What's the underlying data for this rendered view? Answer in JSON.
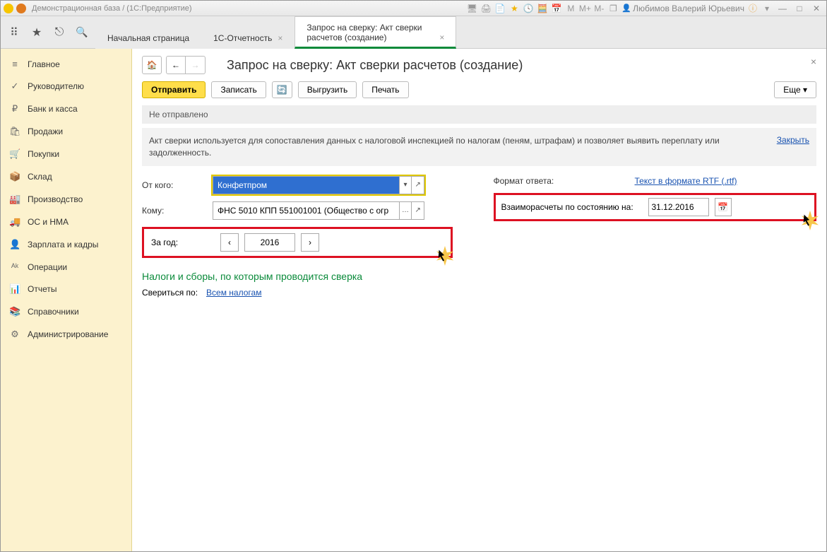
{
  "titlebar": {
    "title": "Демонстрационная база / (1С:Предприятие)",
    "user": "Любимов Валерий Юрьевич",
    "m_labels": [
      "M",
      "M+",
      "M-"
    ]
  },
  "tabs": {
    "items": [
      {
        "label": "Начальная страница"
      },
      {
        "label": "1С-Отчетность"
      },
      {
        "label": "Запрос на сверку: Акт сверки расчетов (создание)"
      }
    ]
  },
  "sidebar": {
    "items": [
      {
        "icon": "≡",
        "label": "Главное"
      },
      {
        "icon": "✓",
        "label": "Руководителю"
      },
      {
        "icon": "₽",
        "label": "Банк и касса"
      },
      {
        "icon": "🛍",
        "label": "Продажи"
      },
      {
        "icon": "🛒",
        "label": "Покупки"
      },
      {
        "icon": "📦",
        "label": "Склад"
      },
      {
        "icon": "🏭",
        "label": "Производство"
      },
      {
        "icon": "🚚",
        "label": "ОС и НМА"
      },
      {
        "icon": "👤",
        "label": "Зарплата и кадры"
      },
      {
        "icon": "ᴬᵏ",
        "label": "Операции"
      },
      {
        "icon": "📊",
        "label": "Отчеты"
      },
      {
        "icon": "📚",
        "label": "Справочники"
      },
      {
        "icon": "⚙",
        "label": "Администрирование"
      }
    ]
  },
  "page": {
    "title": "Запрос на сверку: Акт сверки расчетов (создание)",
    "actions": {
      "send": "Отправить",
      "save": "Записать",
      "export": "Выгрузить",
      "print": "Печать",
      "more": "Еще"
    },
    "status": "Не отправлено",
    "info": "Акт сверки используется для сопоставления данных с налоговой инспекцией по налогам (пеням, штрафам) и позволяет выявить переплату или задолженность.",
    "info_close": "Закрыть",
    "fields": {
      "from_label": "От кого:",
      "from_value": "Конфетпром",
      "to_label": "Кому:",
      "to_value": "ФНС 5010 КПП 551001001 (Общество с огр",
      "year_label": "За год:",
      "year_value": "2016",
      "format_label": "Формат ответа:",
      "format_link": "Текст в формате RTF (.rtf)",
      "balance_label": "Взаиморасчеты по состоянию на:",
      "balance_date": "31.12.2016"
    },
    "section_title": "Налоги и сборы, по которым проводится сверка",
    "check_by_label": "Свериться по:",
    "check_by_link": "Всем налогам"
  }
}
